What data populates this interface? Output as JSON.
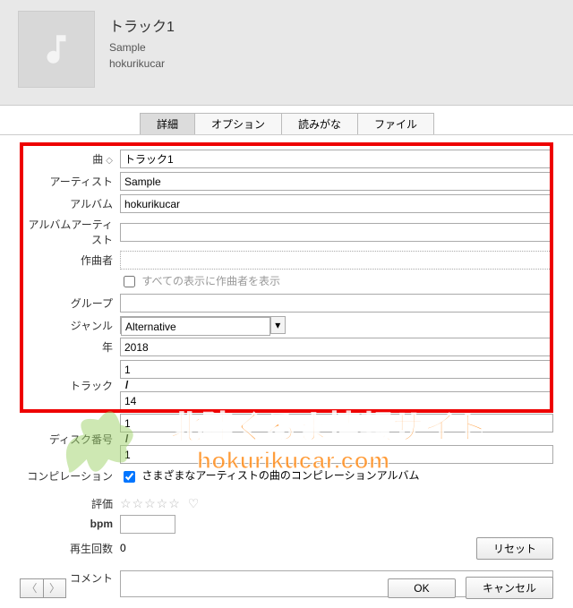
{
  "header": {
    "title": "トラック1",
    "artist": "Sample",
    "album": "hokurikucar"
  },
  "tabs": [
    {
      "label": "詳細",
      "active": true
    },
    {
      "label": "オプション",
      "active": false
    },
    {
      "label": "読みがな",
      "active": false
    },
    {
      "label": "ファイル",
      "active": false
    }
  ],
  "fields": {
    "song_label": "曲",
    "song_value": "トラック1",
    "artist_label": "アーティスト",
    "artist_value": "Sample",
    "album_label": "アルバム",
    "album_value": "hokurikucar",
    "album_artist_label": "アルバムアーティスト",
    "album_artist_value": "",
    "composer_label": "作曲者",
    "composer_value": "",
    "show_composer_label": "すべての表示に作曲者を表示",
    "show_composer_checked": false,
    "group_label": "グループ",
    "group_value": "",
    "genre_label": "ジャンル",
    "genre_value": "Alternative",
    "year_label": "年",
    "year_value": "2018",
    "track_label": "トラック",
    "track_num": "1",
    "track_total": "14",
    "disc_label": "ディスク番号",
    "disc_num": "1",
    "disc_total": "1",
    "compilation_label": "コンピレーション",
    "compilation_text": "さまざまなアーティストの曲のコンピレーションアルバム",
    "compilation_checked": true,
    "rating_label": "評価",
    "bpm_label": "bpm",
    "bpm_value": "",
    "play_count_label": "再生回数",
    "play_count_value": "0",
    "reset_button": "リセット",
    "comment_label": "コメント",
    "comment_value": ""
  },
  "buttons": {
    "ok": "OK",
    "cancel": "キャンセル"
  },
  "watermark": {
    "line1": "北陸くるま情報サイト",
    "line2": "hokurikucar.com"
  }
}
